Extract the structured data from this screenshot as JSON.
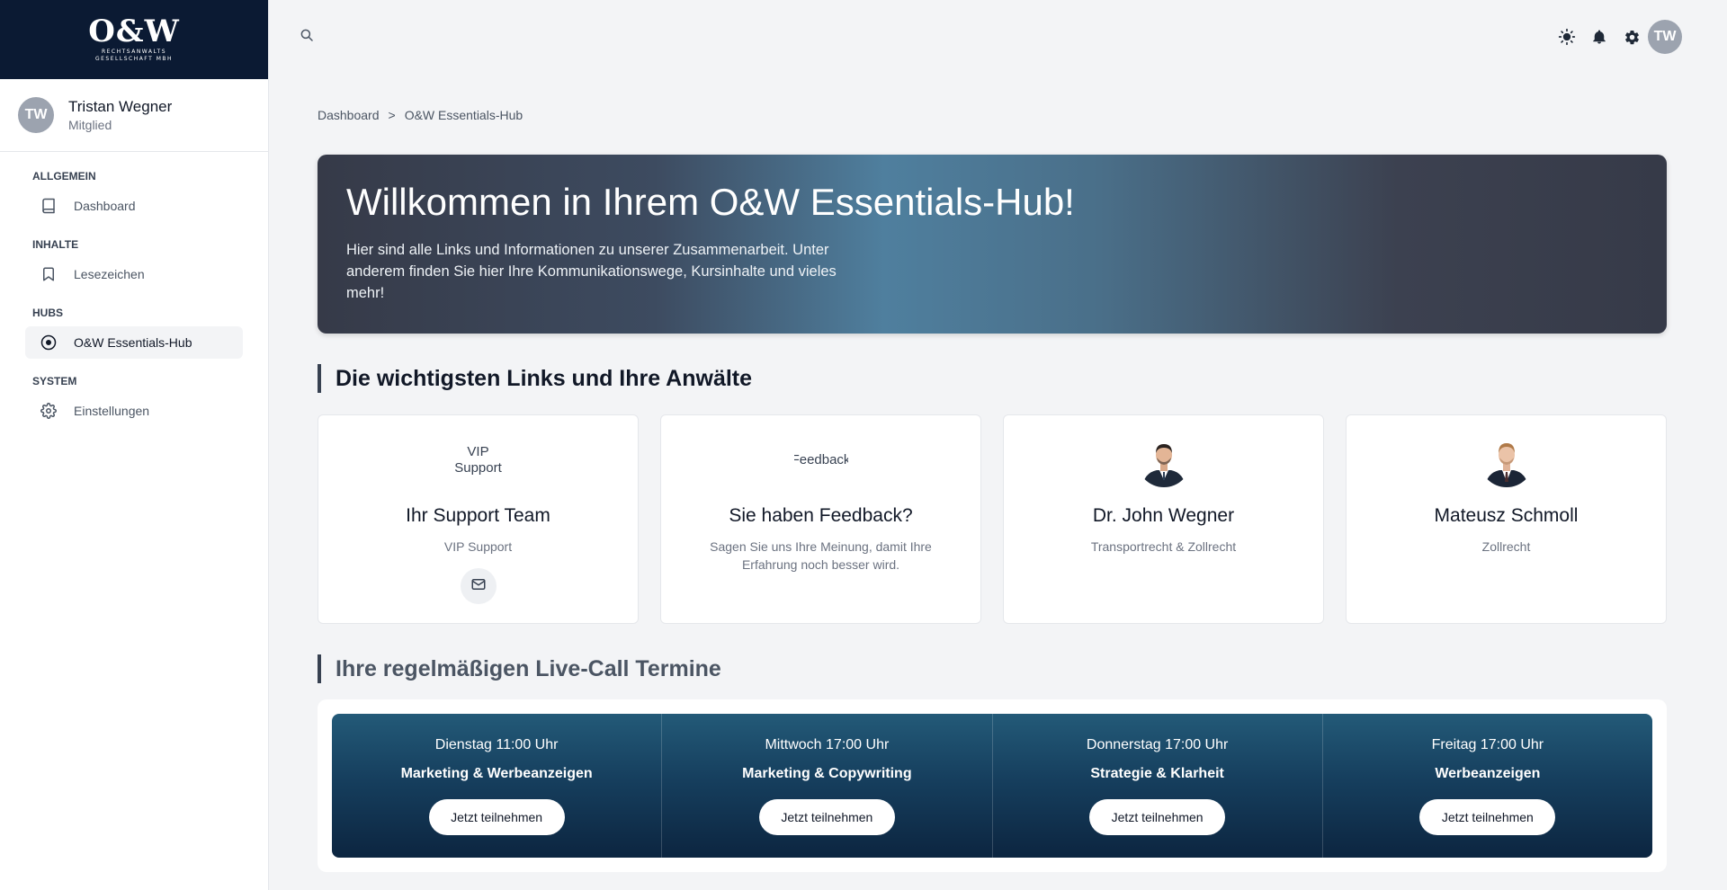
{
  "brand": {
    "logo_main": "O&W",
    "logo_sub_1": "RECHTSANWALTS",
    "logo_sub_2": "GESELLSCHAFT MBH"
  },
  "user": {
    "initials": "TW",
    "name": "Tristan Wegner",
    "role": "Mitglied"
  },
  "sidebar": {
    "sections": [
      {
        "heading": "Allgemein",
        "items": [
          {
            "label": "Dashboard",
            "icon": "book-icon"
          }
        ]
      },
      {
        "heading": "Inhalte",
        "items": [
          {
            "label": "Lesezeichen",
            "icon": "bookmark-icon"
          }
        ]
      },
      {
        "heading": "Hubs",
        "items": [
          {
            "label": "O&W Essentials-Hub",
            "icon": "play-circle-icon",
            "active": true
          }
        ]
      },
      {
        "heading": "System",
        "items": [
          {
            "label": "Einstellungen",
            "icon": "gear-icon"
          }
        ]
      }
    ]
  },
  "topbar": {
    "icons": [
      "search-icon",
      "sun-icon",
      "bell-icon",
      "gear-icon"
    ],
    "avatar_initials": "TW"
  },
  "breadcrumb": {
    "items": [
      "Dashboard",
      "O&W Essentials-Hub"
    ],
    "separator": ">"
  },
  "hero": {
    "title": "Willkommen in Ihrem O&W Essentials-Hub!",
    "text": "Hier sind alle Links und Informationen zu unserer Zusammenarbeit. Unter anderem finden Sie hier Ihre Kommunikationswege, Kursinhalte und vieles mehr!"
  },
  "links_section": {
    "title": "Die wichtigsten Links und Ihre Anwälte",
    "cards": [
      {
        "img_alt": "VIP Support",
        "title": "Ihr Support Team",
        "subtitle": "VIP Support",
        "action_icon": "mail-icon"
      },
      {
        "img_alt": "Feedback",
        "title": "Sie haben Feedback?",
        "subtitle": "Sagen Sie uns Ihre Meinung, damit Ihre Erfahrung noch besser wird."
      },
      {
        "title": "Dr. John Wegner",
        "subtitle": "Transportrecht & Zollrecht"
      },
      {
        "title": "Mateusz Schmoll",
        "subtitle": "Zollrecht"
      }
    ]
  },
  "calls_section": {
    "title": "Ihre regelmäßigen Live-Call Termine",
    "calls": [
      {
        "time": "Dienstag 11:00 Uhr",
        "topic": "Marketing & Werbeanzeigen",
        "button": "Jetzt teilnehmen"
      },
      {
        "time": "Mittwoch 17:00 Uhr",
        "topic": "Marketing & Copywriting",
        "button": "Jetzt teilnehmen"
      },
      {
        "time": "Donnerstag 17:00 Uhr",
        "topic": "Strategie & Klarheit",
        "button": "Jetzt teilnehmen"
      },
      {
        "time": "Freitag 17:00 Uhr",
        "topic": "Werbeanzeigen",
        "button": "Jetzt teilnehmen"
      }
    ]
  },
  "colors": {
    "sidebar_logo_bg": "#0b1a33",
    "calls_bg": "#163f5e",
    "hero_accent": "#4f7f9e"
  }
}
